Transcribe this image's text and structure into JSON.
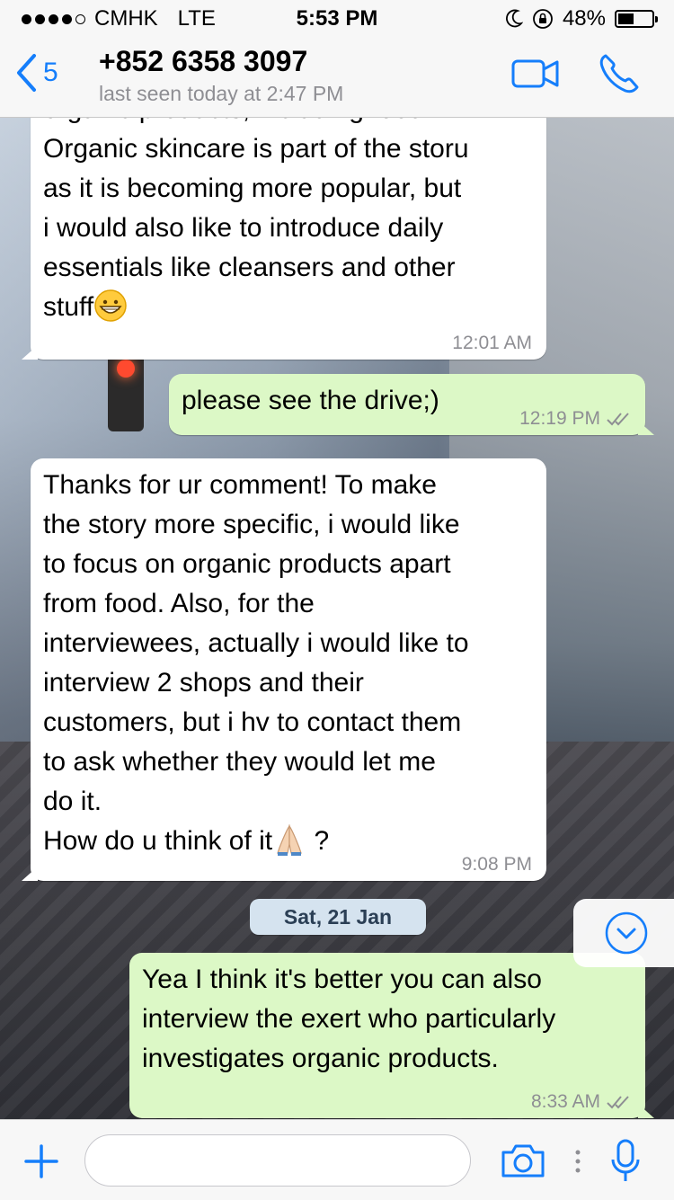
{
  "status_bar": {
    "carrier": "CMHK",
    "network": "LTE",
    "time": "5:53 PM",
    "battery": "48%",
    "battery_level": 0.48
  },
  "header": {
    "back_count": "5",
    "contact_name": "+852 6358 3097",
    "last_seen": "last seen today at 2:47 PM",
    "video_icon": "video-call-icon",
    "call_icon": "phone-icon"
  },
  "messages": [
    {
      "direction": "in",
      "text": "organic products, including food.\nOrganic skincare is part of the storu\nas it is becoming more popular, but\ni would also like to introduce daily\nessentials like cleansers and other\nstuff",
      "emoji": "grinning-face",
      "time": "12:01 AM"
    },
    {
      "direction": "out",
      "text": "please see the drive;)",
      "time": "12:19 PM",
      "ticks": "read"
    },
    {
      "direction": "in",
      "text": "Thanks for ur comment! To make\nthe story more specific, i would like\nto focus on organic products apart\nfrom food. Also, for the\ninterviewees, actually i would like to\ninterview 2 shops and their\ncustomers, but i hv to contact them\nto ask whether they would let me\ndo it.\nHow do u think of it",
      "emoji": "folded-hands",
      "after_emoji": " ?",
      "time": "9:08 PM"
    },
    {
      "direction": "out",
      "text": "Yea I think it's better you can also\ninterview the exert who particularly\ninvestigates organic products.",
      "time": "8:33 AM",
      "ticks": "read"
    }
  ],
  "date_separator": "Sat, 21 Jan",
  "input": {
    "placeholder": "",
    "add_icon": "plus-icon",
    "camera_icon": "camera-icon",
    "mic_icon": "microphone-icon"
  },
  "colors": {
    "accent": "#157efb",
    "incoming_bubble": "#ffffff",
    "outgoing_bubble": "#dcf8c6",
    "read_ticks": "#8e8e93"
  }
}
